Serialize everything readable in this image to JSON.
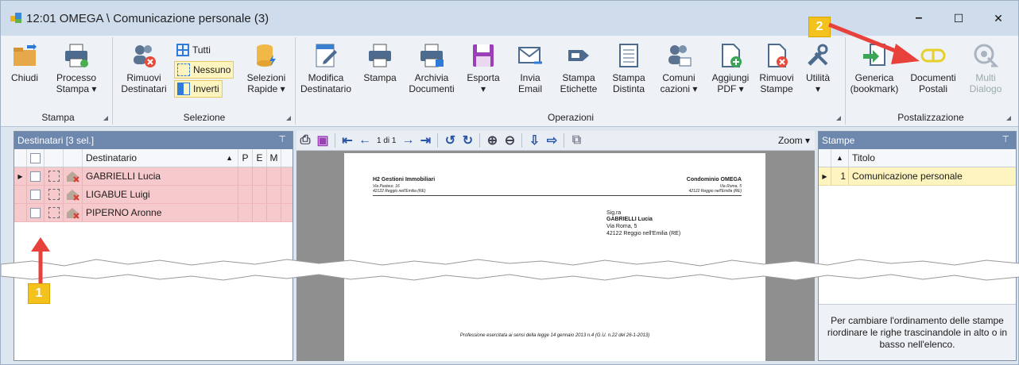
{
  "window": {
    "title": "12:01 OMEGA \\ Comunicazione personale (3)",
    "minimize": "–",
    "maximize": "☐",
    "close": "✕"
  },
  "ribbon": {
    "stampa_group": {
      "label": "Stampa",
      "buttons": [
        {
          "label": "Chiudi"
        },
        {
          "label": "Processo\nStampa ▾"
        }
      ]
    },
    "selezione_group": {
      "label": "Selezione",
      "rimuovi": "Rimuovi\nDestinatari",
      "tutti": "Tutti",
      "nessuno": "Nessuno",
      "inverti": "Inverti",
      "selezioni": "Selezioni\nRapide ▾"
    },
    "operazioni_group": {
      "label": "Operazioni",
      "buttons": [
        {
          "label": "Modifica\nDestinatario"
        },
        {
          "label": "Stampa"
        },
        {
          "label": "Archivia\nDocumenti"
        },
        {
          "label": "Esporta\n▾"
        },
        {
          "label": "Invia\nEmail"
        },
        {
          "label": "Stampa\nEtichette"
        },
        {
          "label": "Stampa\nDistinta"
        },
        {
          "label": "Comuni\ncazioni ▾"
        },
        {
          "label": "Aggiungi\nPDF ▾"
        },
        {
          "label": "Rimuovi\nStampe"
        },
        {
          "label": "Utilità\n▾"
        }
      ]
    },
    "postalizzazione_group": {
      "label": "Postalizzazione",
      "buttons": [
        {
          "label": "Generica\n(bookmark)"
        },
        {
          "label": "Documenti\nPostali"
        },
        {
          "label": "Multi\nDialogo"
        }
      ]
    }
  },
  "left_pane": {
    "header": "Destinatari [3 sel.]",
    "columns": [
      "Destinatario",
      "P",
      "E",
      "M"
    ],
    "rows": [
      {
        "name": "GABRIELLI Lucia"
      },
      {
        "name": "LIGABUE Luigi"
      },
      {
        "name": "PIPERNO Aronne"
      }
    ]
  },
  "preview": {
    "page_indicator": "1 di 1",
    "zoom": "Zoom ▾",
    "doc": {
      "sender_name": "H2 Gestioni Immobiliari",
      "sender_addr1": "Via Pasteur, 16",
      "sender_addr2": "42122 Reggio nell'Emilia (RE)",
      "cond_name": "Condominio OMEGA",
      "cond_addr1": "Via Roma, 5",
      "cond_addr2": "42122 Reggio nell'Emilia (RE)",
      "rec_salutation": "Sig.ra",
      "rec_name": "GABRIELLI Lucia",
      "rec_addr1": "Via Roma, 5",
      "rec_addr2": "42122 Reggio nell'Emilia (RE)",
      "footer": "Professione esercitata ai sensi della legge 14 gennaio 2013 n.4 (G.U. n.22 del 26-1-2013)"
    }
  },
  "right_pane": {
    "header": "Stampe",
    "column": "Titolo",
    "rows": [
      {
        "num": "1",
        "title": "Comunicazione personale"
      }
    ],
    "hint": "Per cambiare l'ordinamento delle stampe riordinare le righe trascinandole in alto o in basso nell'elenco."
  },
  "callouts": {
    "one": "1",
    "two": "2"
  },
  "colors": {
    "selected_row": "#f6c9cc",
    "pane_header": "#6d87ad",
    "highlight_row": "#fdf4bf",
    "callout": "#f3c21c",
    "arrow": "#e8413b"
  }
}
